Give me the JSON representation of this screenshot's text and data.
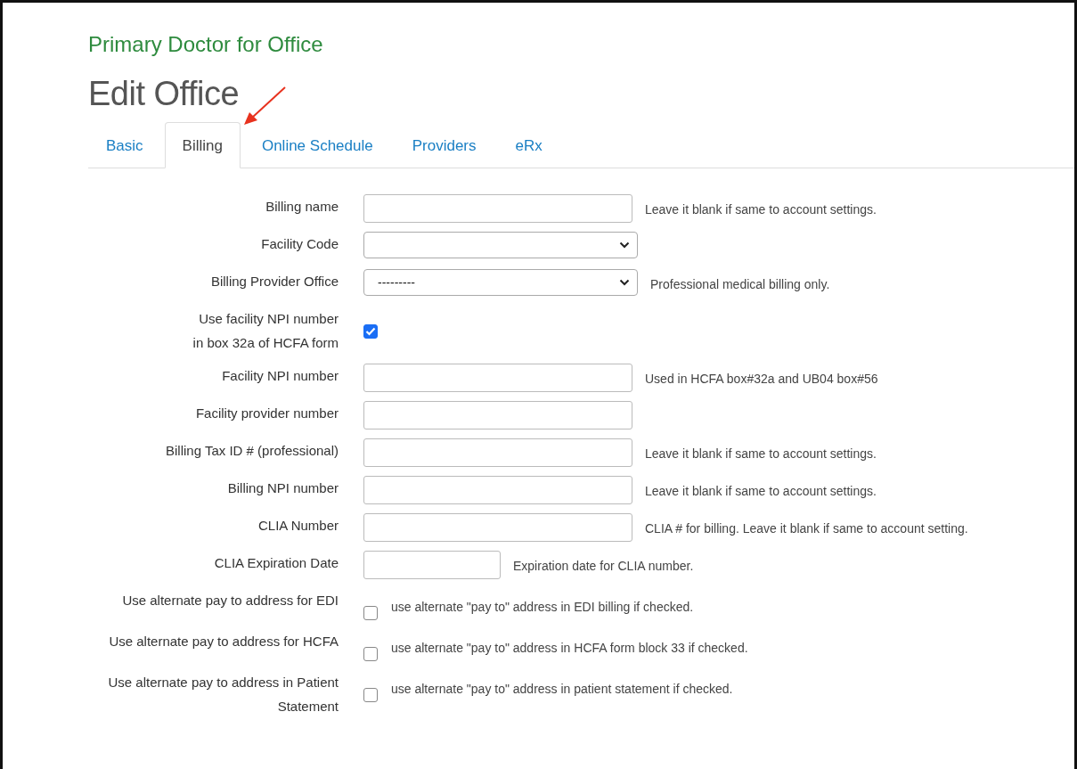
{
  "page_title": "Primary Doctor for Office",
  "heading": "Edit Office",
  "tabs": [
    {
      "label": "Basic",
      "selected": false
    },
    {
      "label": "Billing",
      "selected": true
    },
    {
      "label": "Online Schedule",
      "selected": false
    },
    {
      "label": "Providers",
      "selected": false
    },
    {
      "label": "eRx",
      "selected": false
    }
  ],
  "fields": [
    {
      "kind": "text",
      "label": "Billing name",
      "hint": "Leave it blank if same to account settings."
    },
    {
      "kind": "select",
      "label": "Facility Code"
    },
    {
      "kind": "select",
      "label": "Billing Provider Office",
      "value": "---------",
      "hint": "Professional medical billing only."
    },
    {
      "kind": "checkbox",
      "label": "Use facility NPI number\nin box 32a of HCFA form",
      "checked": true
    },
    {
      "kind": "text",
      "label": "Facility NPI number",
      "hint": "Used in HCFA box#32a and UB04 box#56"
    },
    {
      "kind": "text",
      "label": "Facility provider number"
    },
    {
      "kind": "text",
      "label": "Billing Tax ID # (professional)",
      "hint": "Leave it blank if same to account settings."
    },
    {
      "kind": "text",
      "label": "Billing NPI number",
      "hint": "Leave it blank if same to account settings."
    },
    {
      "kind": "text",
      "label": "CLIA Number",
      "hint": "CLIA # for billing. Leave it blank if same to account setting."
    },
    {
      "kind": "date",
      "label": "CLIA Expiration Date",
      "hint": "Expiration date for CLIA number."
    },
    {
      "kind": "checkbox",
      "label": "Use alternate pay to address for EDI",
      "checked": false,
      "hint": "use alternate \"pay to\" address in EDI billing if checked."
    },
    {
      "kind": "checkbox",
      "label": "Use alternate pay to address for HCFA",
      "checked": false,
      "hint": "use alternate \"pay to\" address in HCFA form block 33 if checked."
    },
    {
      "kind": "checkbox",
      "label": "Use alternate pay to address in Patient Statement",
      "checked": false,
      "hint": "use alternate \"pay to\" address in patient statement if checked."
    }
  ]
}
